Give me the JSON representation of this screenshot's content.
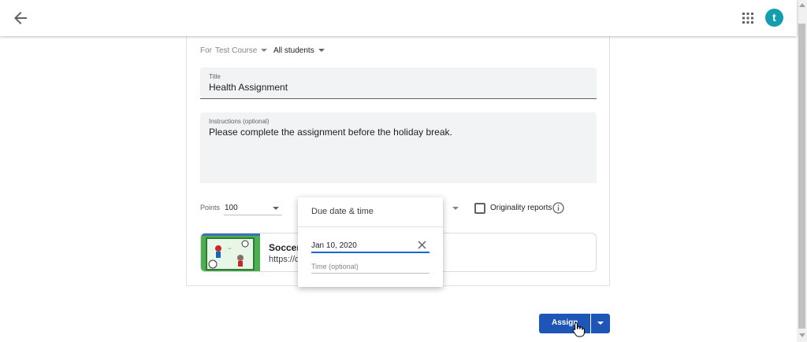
{
  "header": {
    "back_icon": "arrow-back-icon",
    "apps_icon": "apps-grid-icon",
    "avatar_letter": "t",
    "avatar_color": "#129eaf"
  },
  "assignment": {
    "for_label": "For",
    "course": "Test Course",
    "students": "All students",
    "title_label": "Title",
    "title_value": "Health Assignment",
    "instructions_label": "Instructions (optional)",
    "instructions_value": "Please complete the assignment before the holiday break.",
    "points_label": "Points",
    "points_value": "100",
    "originality_label": "Originality reports",
    "originality_checked": false
  },
  "attachment": {
    "title": "Soccer",
    "url": "https://q"
  },
  "due_popup": {
    "title": "Due date & time",
    "date_value": "Jan 10, 2020",
    "time_placeholder": "Time (optional)"
  },
  "actions": {
    "assign_label": "Assign",
    "accent": "#1e56b8"
  }
}
